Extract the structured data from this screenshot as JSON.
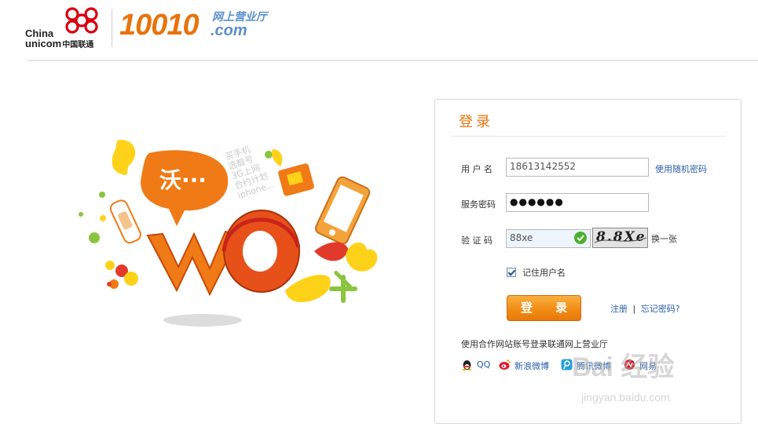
{
  "header": {
    "logo_en_line1": "China",
    "logo_en_line2": "unicom",
    "logo_cn": "中国联通",
    "brand_number": "10010",
    "brand_subtitle": "网上营业厅",
    "brand_domain": ".com"
  },
  "illustration": {
    "bubble_text": "沃···",
    "tagline_lines": [
      "买手机",
      "选靓号",
      "3G上网",
      "合约计划",
      "iphone..."
    ]
  },
  "login": {
    "title": "登录",
    "username_label": "用 户 名",
    "username_value": "18613142552",
    "random_password_link": "使用随机密码",
    "password_label": "服务密码",
    "password_value": "●●●●●●",
    "captcha_label": "验 证 码",
    "captcha_value": "88xe",
    "captcha_image_text": "8.8Xe",
    "refresh_link": "换一张",
    "remember_label": "记住用户名",
    "remember_checked": true,
    "login_button": "登 录",
    "register_link": "注册",
    "separator": "|",
    "forgot_link": "忘记密码?",
    "partner_hint": "使用合作网站账号登录联通网上营业厅",
    "partners": [
      {
        "label": "QQ",
        "icon": "qq-penguin-icon"
      },
      {
        "label": "新浪微博",
        "icon": "sina-weibo-icon"
      },
      {
        "label": "腾讯微博",
        "icon": "tencent-weibo-icon"
      },
      {
        "label": "网易",
        "icon": "netease-icon"
      }
    ]
  },
  "watermark": {
    "main": "Bai 经验",
    "sub": "jingyan.baidu.com"
  },
  "colors": {
    "brand_orange": "#e8730c",
    "brand_blue": "#5b8fcb",
    "link_blue": "#2a5fa8",
    "unicom_red": "#d7000f"
  }
}
